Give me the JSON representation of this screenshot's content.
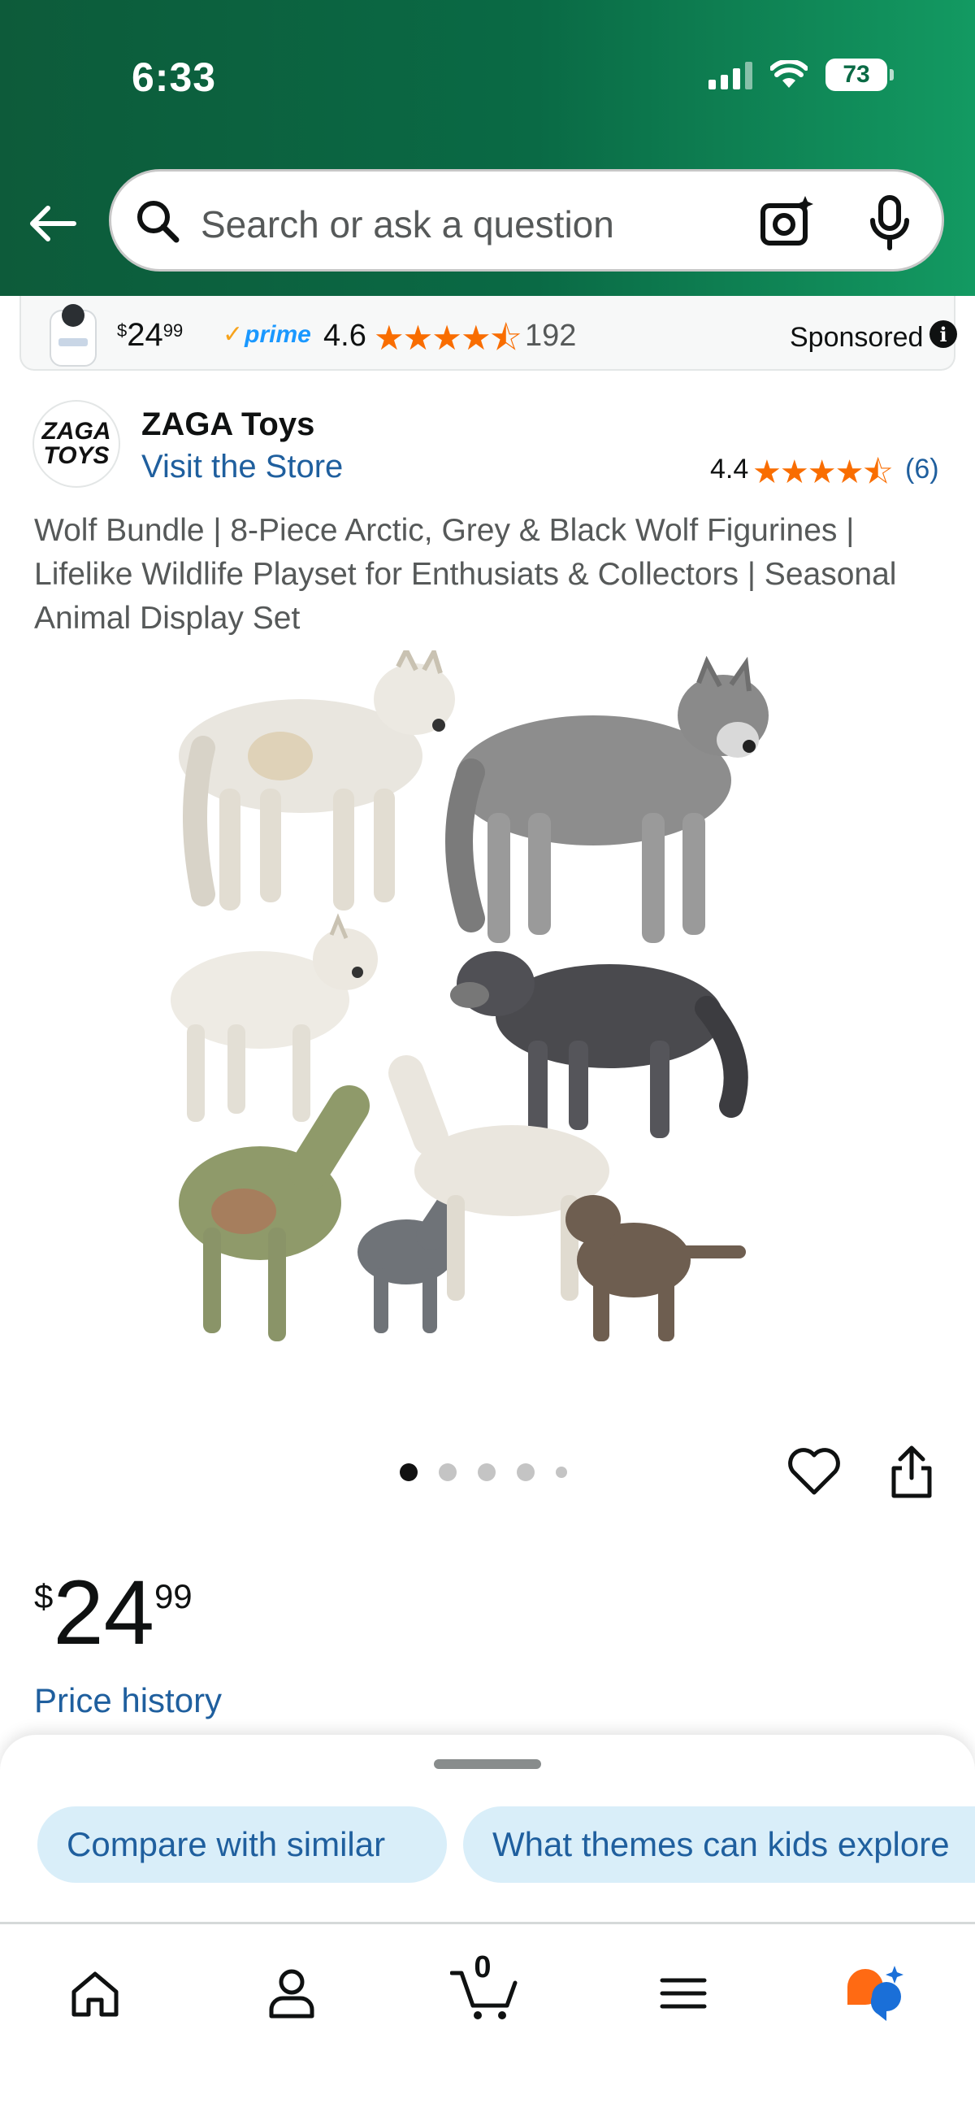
{
  "status_bar": {
    "time": "6:33",
    "battery": "73"
  },
  "search": {
    "placeholder": "Search or ask a question"
  },
  "sponsored_ad": {
    "price_whole": "24",
    "price_fraction": "99",
    "currency": "$",
    "prime_label": "prime",
    "rating": "4.6",
    "stars": "★★★★⯪",
    "review_count": "192",
    "label": "Sponsored"
  },
  "store": {
    "logo_line1": "ZAGA",
    "logo_line2": "TOYS",
    "name": "ZAGA Toys",
    "visit_link": "Visit the Store",
    "rating": "4.4",
    "stars": "★★★★⯪",
    "review_count": "(6)"
  },
  "product": {
    "title": "Wolf Bundle | 8-Piece Arctic, Grey & Black Wolf Figurines | Lifelike Wildlife Playset for Enthusiats & Collectors | Seasonal Animal Display Set",
    "carousel": {
      "total": 5,
      "active": 1
    },
    "price": {
      "currency": "$",
      "whole": "24",
      "fraction": "99"
    },
    "price_history_link": "Price history"
  },
  "suggestions": {
    "chips": [
      "Compare with similar",
      "What themes can kids explore"
    ]
  },
  "tabbar": {
    "cart_count": "0",
    "items": [
      "home-tab",
      "account-tab",
      "cart-tab",
      "menu-tab",
      "rufus-tab"
    ]
  },
  "colors": {
    "header_green": "#0a6a45",
    "link_blue": "#1f5f9e",
    "star_orange": "#f96d00",
    "chip_bg": "#d9eef9",
    "prime_blue": "#1a98ff"
  }
}
